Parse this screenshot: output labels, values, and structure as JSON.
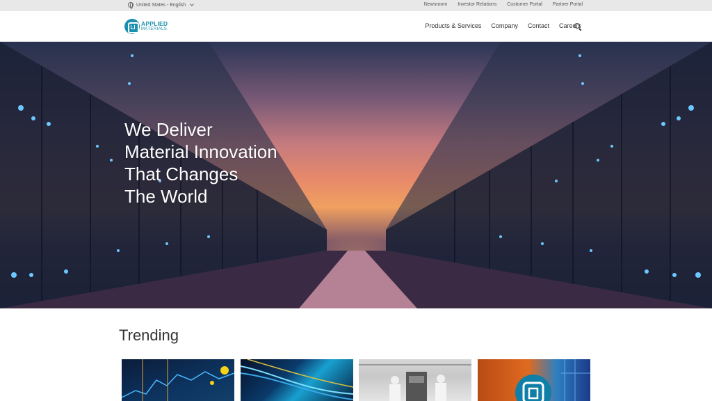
{
  "utility": {
    "locale": "United States - English",
    "links": [
      "Newsroom",
      "Investor Relations",
      "Customer Portal",
      "Partner Portal"
    ]
  },
  "header": {
    "logo_line1": "APPLIED",
    "logo_line2": "MATERIALS.",
    "nav": [
      "Products & Services",
      "Company",
      "Contact",
      "Careers"
    ],
    "search_icon": "search-icon"
  },
  "hero": {
    "headline": [
      "We Deliver",
      "Material Innovation",
      "That Changes",
      "The World"
    ]
  },
  "trending": {
    "title": "Trending"
  },
  "colors": {
    "brand": "#1b8fae",
    "utility_bar": "#e8e8e8"
  }
}
